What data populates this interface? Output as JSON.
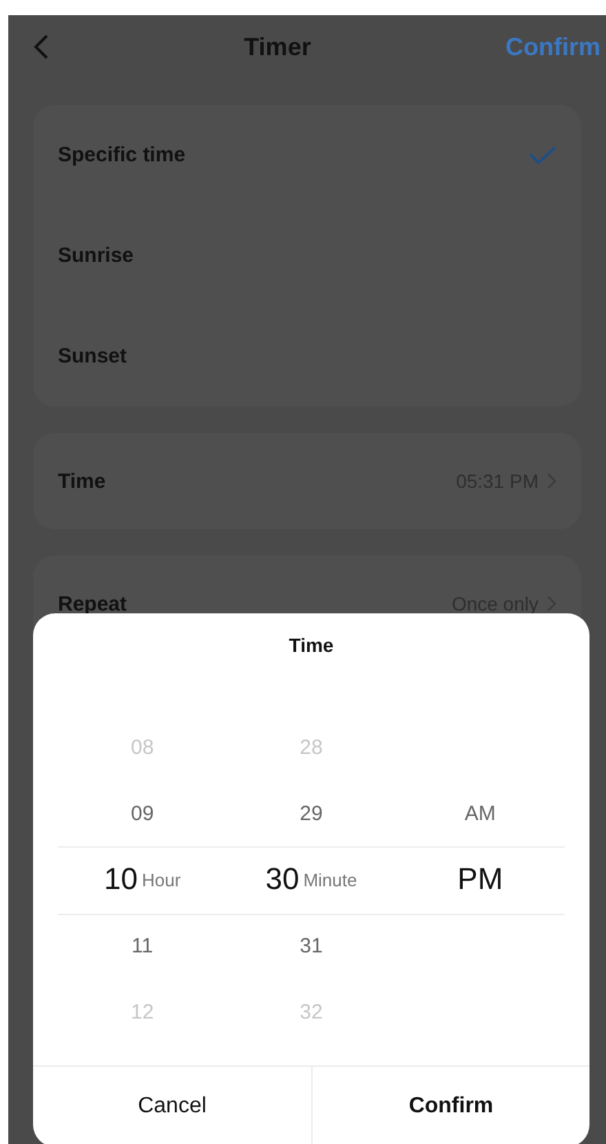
{
  "header": {
    "title": "Timer",
    "confirm": "Confirm"
  },
  "modes": [
    {
      "label": "Specific time",
      "selected": true
    },
    {
      "label": "Sunrise",
      "selected": false
    },
    {
      "label": "Sunset",
      "selected": false
    }
  ],
  "settings": [
    {
      "label": "Time",
      "value": "05:31 PM"
    },
    {
      "label": "Repeat",
      "value": "Once only"
    }
  ],
  "picker": {
    "title": "Time",
    "columns": [
      {
        "unit": "Hour",
        "items": [
          {
            "label": "08",
            "selected": false
          },
          {
            "label": "09",
            "selected": false
          },
          {
            "label": "10",
            "selected": true
          },
          {
            "label": "11",
            "selected": false
          },
          {
            "label": "12",
            "selected": false
          }
        ]
      },
      {
        "unit": "Minute",
        "items": [
          {
            "label": "28",
            "selected": false
          },
          {
            "label": "29",
            "selected": false
          },
          {
            "label": "30",
            "selected": true
          },
          {
            "label": "31",
            "selected": false
          },
          {
            "label": "32",
            "selected": false
          }
        ]
      },
      {
        "items": [
          {
            "label": "AM",
            "selected": false
          },
          {
            "label": "PM",
            "selected": true
          }
        ]
      }
    ],
    "cancel": "Cancel",
    "confirm": "Confirm"
  }
}
